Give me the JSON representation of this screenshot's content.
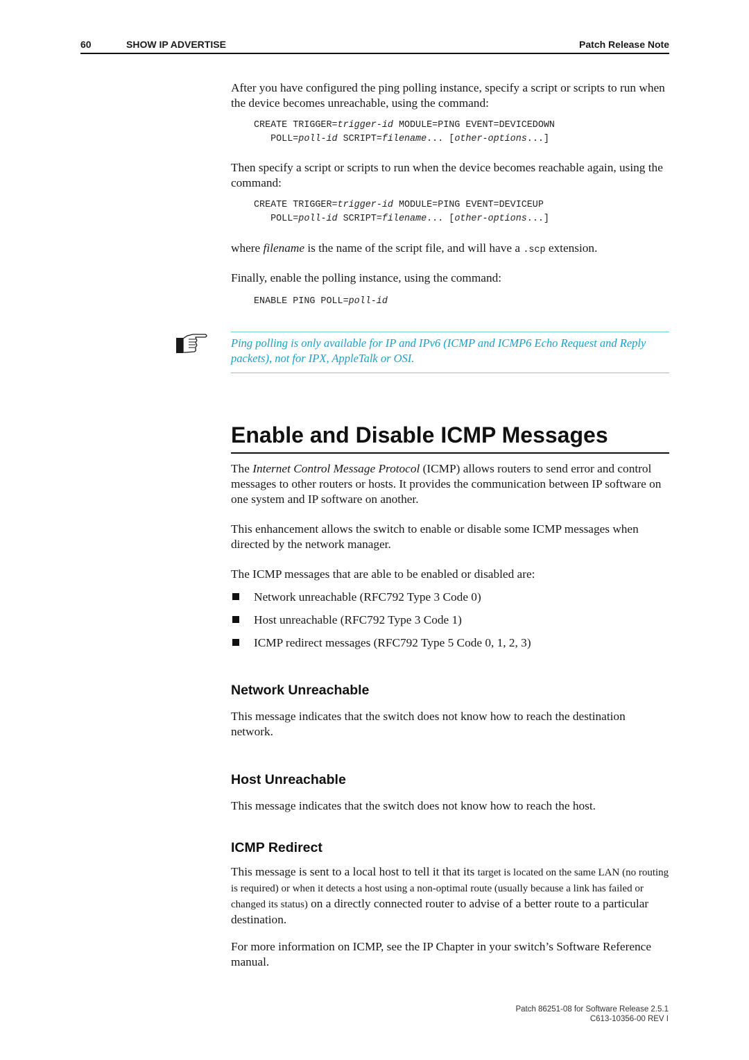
{
  "header": {
    "page_number": "60",
    "section": "SHOW IP ADVERTISE",
    "document": "Patch Release Note"
  },
  "intro": {
    "para1": "After you have configured the ping polling instance, specify a script or scripts to run when the device becomes unreachable, using the command:",
    "cmd_down": {
      "l1_a": "CREATE TRIGGER=",
      "l1_b": "trigger-id",
      "l1_c": " MODULE=PING EVENT=DEVICEDOWN",
      "l2_a": "POLL=",
      "l2_b": "poll-id",
      "l2_c": " SCRIPT=",
      "l2_d": "filename",
      "l2_e": "... [",
      "l2_f": "other-options",
      "l2_g": "...]"
    },
    "para2": "Then specify a script or scripts to run when the device becomes reachable again, using the command:",
    "cmd_up": {
      "l1_a": "CREATE TRIGGER=",
      "l1_b": "trigger-id",
      "l1_c": " MODULE=PING EVENT=DEVICEUP",
      "l2_a": "POLL=",
      "l2_b": "poll-id",
      "l2_c": " SCRIPT=",
      "l2_d": "filename",
      "l2_e": "... [",
      "l2_f": "other-options",
      "l2_g": "...]"
    },
    "para3": {
      "a": "where ",
      "b": "filename",
      "c": " is the name of the script file, and will have a ",
      "d": ".scp",
      "e": " extension."
    },
    "para4": "Finally, enable the polling instance, using the command:",
    "cmd_enable": {
      "a": "ENABLE PING POLL=",
      "b": "poll-id"
    }
  },
  "note": {
    "icon": "pointing-hand-icon",
    "text": "Ping polling is only available for IP and IPv6 (ICMP and ICMP6 Echo Request and Reply packets), not for IPX, AppleTalk or OSI.",
    "color": "#1aa0c8",
    "rule_color": "#6fd3d3"
  },
  "section": {
    "title": "Enable and Disable ICMP Messages",
    "para1": {
      "a": "The ",
      "b": "Internet Control Message Protocol",
      "c": " (ICMP) allows routers to send error and control messages to other routers or hosts. It provides the communication between IP software on one system and IP software on another."
    },
    "para2": "This enhancement allows the switch to enable or disable some ICMP messages when directed by the network manager.",
    "para3": "The ICMP messages that are able to be enabled or disabled are:",
    "bullets": [
      "Network unreachable (RFC792 Type 3 Code 0)",
      "Host unreachable (RFC792 Type 3 Code 1)",
      "ICMP redirect messages (RFC792 Type 5 Code 0, 1, 2, 3)"
    ]
  },
  "subsections": [
    {
      "title": "Network Unreachable",
      "text": "This message indicates that the switch does not know how to reach the destination network."
    },
    {
      "title": "Host Unreachable",
      "text": "This message indicates that the switch does not know how to reach the host."
    },
    {
      "title": "ICMP Redirect",
      "text_a": "This message is sent to a local host to tell it that its ",
      "text_b": "target is located on the same LAN (no routing is required) or when it detects a host using a non-optimal route (usually because a link has failed or changed its status)",
      "text_c": " on a directly connected router to advise of a better route to a particular destination."
    }
  ],
  "closing": "For more information on ICMP, see the IP Chapter in your switch’s Software Reference manual.",
  "footer": {
    "line1": "Patch 86251-08 for Software Release 2.5.1",
    "line2": "C613-10356-00 REV I"
  }
}
